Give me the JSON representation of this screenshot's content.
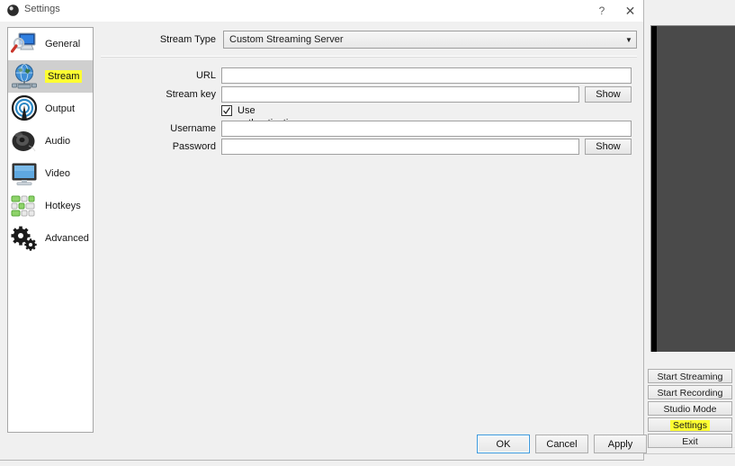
{
  "dialog": {
    "title": "Settings",
    "icon": "obs-logo-icon",
    "help_label": "?",
    "close_label": "✕"
  },
  "sidebar": {
    "items": [
      {
        "label": "General",
        "icon": "general-monitor-magnifier-icon",
        "selected": false,
        "highlighted": false
      },
      {
        "label": "Stream",
        "icon": "stream-globe-icon",
        "selected": true,
        "highlighted": true
      },
      {
        "label": "Output",
        "icon": "output-broadcast-icon",
        "selected": false,
        "highlighted": false
      },
      {
        "label": "Audio",
        "icon": "audio-speaker-icon",
        "selected": false,
        "highlighted": false
      },
      {
        "label": "Video",
        "icon": "video-monitor-icon",
        "selected": false,
        "highlighted": false
      },
      {
        "label": "Hotkeys",
        "icon": "hotkeys-keyboard-icon",
        "selected": false,
        "highlighted": false
      },
      {
        "label": "Advanced",
        "icon": "advanced-gears-icon",
        "selected": false,
        "highlighted": false
      }
    ]
  },
  "stream_page": {
    "stream_type": {
      "label": "Stream Type",
      "value": "Custom Streaming Server",
      "arrow_icon": "chevron-down-icon"
    },
    "url": {
      "label": "URL",
      "value": "",
      "placeholder": ""
    },
    "stream_key": {
      "label": "Stream key",
      "value": "",
      "placeholder": "",
      "show_label": "Show"
    },
    "use_authentication": {
      "label": "Use authentication",
      "checked": true
    },
    "username": {
      "label": "Username",
      "value": "",
      "placeholder": ""
    },
    "password": {
      "label": "Password",
      "value": "",
      "placeholder": "",
      "show_label": "Show"
    }
  },
  "footer": {
    "ok_label": "OK",
    "cancel_label": "Cancel",
    "apply_label": "Apply"
  },
  "obs_main": {
    "buttons": [
      {
        "label": "Start Streaming",
        "highlighted": false
      },
      {
        "label": "Start Recording",
        "highlighted": false
      },
      {
        "label": "Studio Mode",
        "highlighted": false
      },
      {
        "label": "Settings",
        "highlighted": true
      },
      {
        "label": "Exit",
        "highlighted": false
      }
    ]
  },
  "colors": {
    "highlight": "#fdfd32",
    "dialog_bg": "#f0f0f0",
    "selected_row": "#cfcfcf",
    "preview_bg": "#4a4a4a",
    "default_button_border": "#3c99dc"
  }
}
